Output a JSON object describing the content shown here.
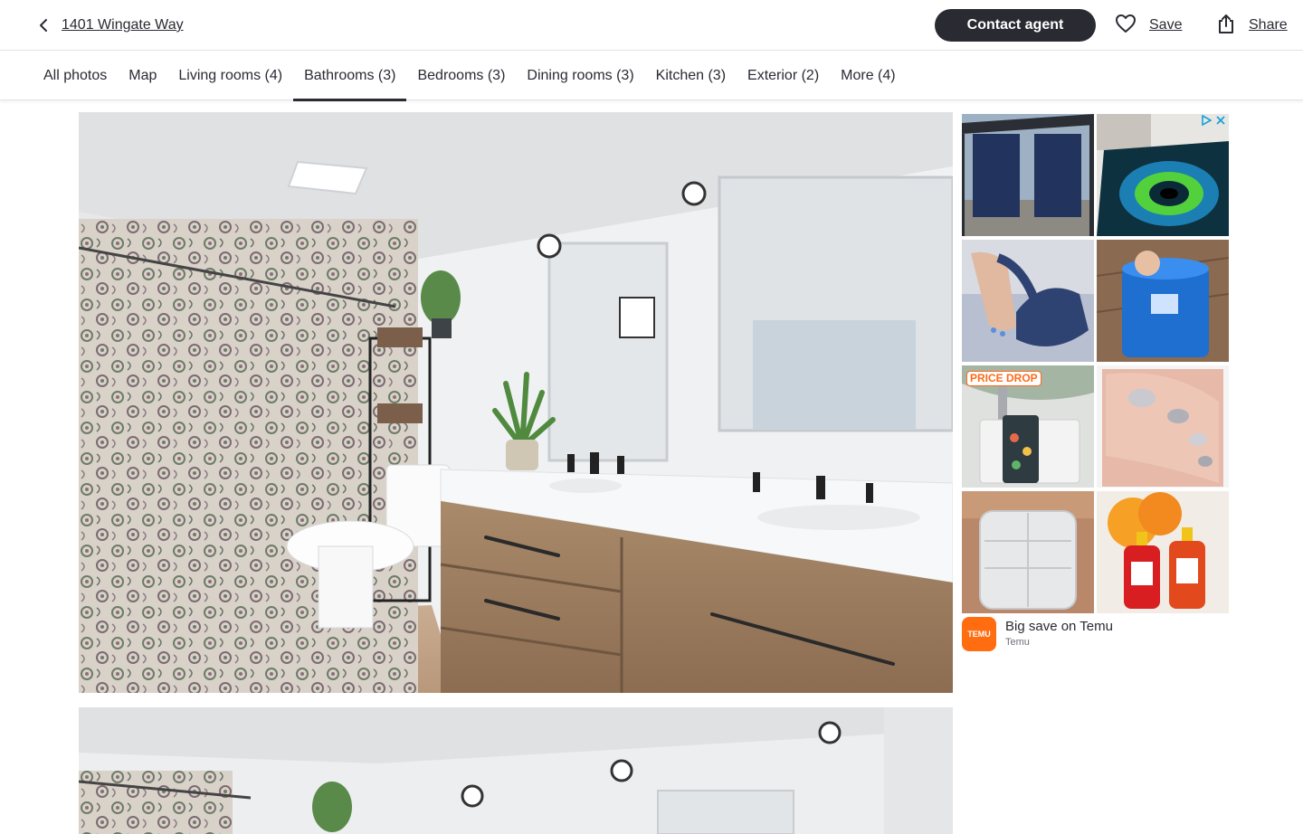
{
  "header": {
    "address": "1401 Wingate Way",
    "contact_label": "Contact agent",
    "save_label": "Save",
    "share_label": "Share"
  },
  "tabs": [
    {
      "label": "All photos"
    },
    {
      "label": "Map"
    },
    {
      "label": "Living rooms (4)"
    },
    {
      "label": "Bathrooms (3)",
      "active": true
    },
    {
      "label": "Bedrooms (3)"
    },
    {
      "label": "Dining rooms (3)"
    },
    {
      "label": "Kitchen (3)"
    },
    {
      "label": "Exterior (2)"
    },
    {
      "label": "More (4)"
    }
  ],
  "ad": {
    "badge": "PRICE DROP",
    "title": "Big save on Temu",
    "brand": "Temu",
    "logo_text": "TEMU",
    "accent": "#ff6d10"
  },
  "colors": {
    "text": "#2a2a33",
    "button_bg": "#2a2a33",
    "divider": "#e3e3e6"
  }
}
